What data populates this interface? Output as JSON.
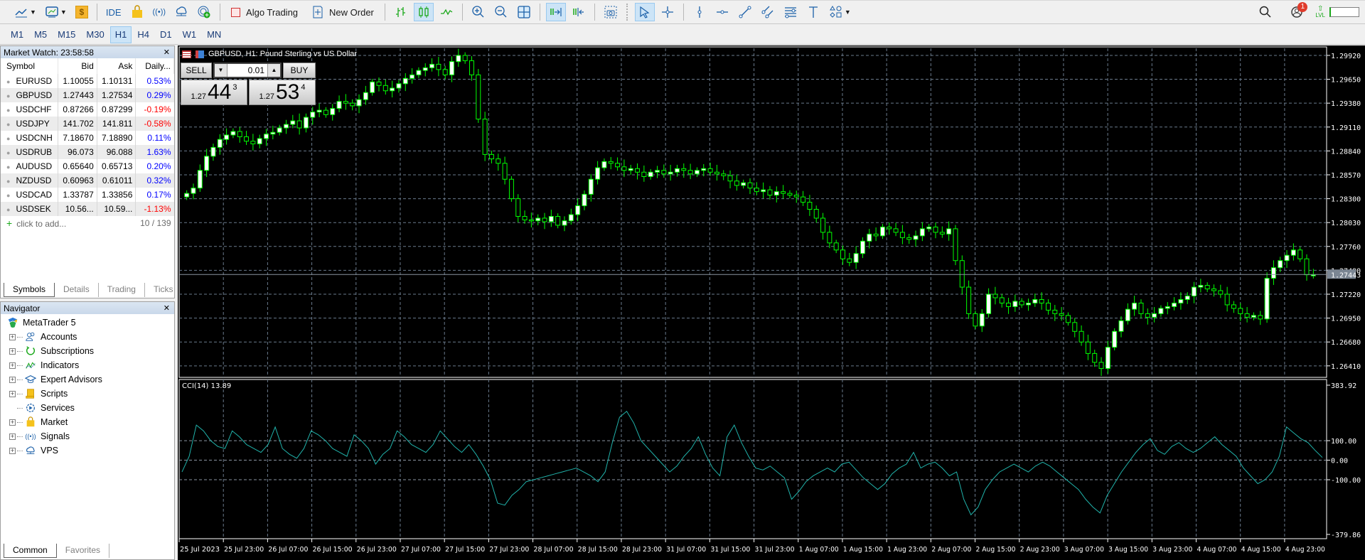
{
  "toolbar": {
    "algo_trading": "Algo Trading",
    "new_order": "New Order",
    "ide": "IDE",
    "notification_count": "1",
    "level_label": "LVL"
  },
  "timeframes": [
    {
      "label": "M1",
      "active": false
    },
    {
      "label": "M5",
      "active": false
    },
    {
      "label": "M15",
      "active": false
    },
    {
      "label": "M30",
      "active": false
    },
    {
      "label": "H1",
      "active": true
    },
    {
      "label": "H4",
      "active": false
    },
    {
      "label": "D1",
      "active": false
    },
    {
      "label": "W1",
      "active": false
    },
    {
      "label": "MN",
      "active": false
    }
  ],
  "market_watch": {
    "title": "Market Watch: 23:58:58",
    "columns": [
      "Symbol",
      "Bid",
      "Ask",
      "Daily..."
    ],
    "rows": [
      {
        "symbol": "EURUSD",
        "bid": "1.10055",
        "ask": "1.10131",
        "daily": "0.53%",
        "dir": "pos"
      },
      {
        "symbol": "GBPUSD",
        "bid": "1.27443",
        "ask": "1.27534",
        "daily": "0.29%",
        "dir": "pos"
      },
      {
        "symbol": "USDCHF",
        "bid": "0.87266",
        "ask": "0.87299",
        "daily": "-0.19%",
        "dir": "neg"
      },
      {
        "symbol": "USDJPY",
        "bid": "141.702",
        "ask": "141.811",
        "daily": "-0.58%",
        "dir": "neg"
      },
      {
        "symbol": "USDCNH",
        "bid": "7.18670",
        "ask": "7.18890",
        "daily": "0.11%",
        "dir": "pos"
      },
      {
        "symbol": "USDRUB",
        "bid": "96.073",
        "ask": "96.088",
        "daily": "1.63%",
        "dir": "pos"
      },
      {
        "symbol": "AUDUSD",
        "bid": "0.65640",
        "ask": "0.65713",
        "daily": "0.20%",
        "dir": "pos"
      },
      {
        "symbol": "NZDUSD",
        "bid": "0.60963",
        "ask": "0.61011",
        "daily": "0.32%",
        "dir": "pos"
      },
      {
        "symbol": "USDCAD",
        "bid": "1.33787",
        "ask": "1.33856",
        "daily": "0.17%",
        "dir": "pos"
      },
      {
        "symbol": "USDSEK",
        "bid": "10.56...",
        "ask": "10.59...",
        "daily": "-1.13%",
        "dir": "neg"
      }
    ],
    "add_label": "click to add...",
    "count": "10 / 139",
    "tabs": [
      "Symbols",
      "Details",
      "Trading",
      "Ticks"
    ],
    "active_tab": "Symbols"
  },
  "navigator": {
    "title": "Navigator",
    "root": "MetaTrader 5",
    "items": [
      {
        "label": "Accounts",
        "icon": "accounts-icon",
        "expandable": true
      },
      {
        "label": "Subscriptions",
        "icon": "subscriptions-icon",
        "expandable": true
      },
      {
        "label": "Indicators",
        "icon": "indicators-icon",
        "expandable": true
      },
      {
        "label": "Expert Advisors",
        "icon": "expert-advisors-icon",
        "expandable": true
      },
      {
        "label": "Scripts",
        "icon": "scripts-icon",
        "expandable": true
      },
      {
        "label": "Services",
        "icon": "services-icon",
        "expandable": false
      },
      {
        "label": "Market",
        "icon": "market-icon",
        "expandable": true
      },
      {
        "label": "Signals",
        "icon": "signals-icon",
        "expandable": true
      },
      {
        "label": "VPS",
        "icon": "vps-icon",
        "expandable": true
      }
    ],
    "tabs": [
      "Common",
      "Favorites"
    ],
    "active_tab": "Common"
  },
  "chart": {
    "title": "GBPUSD, H1:  Pound Sterling vs US Dollar",
    "trade": {
      "sell": "SELL",
      "buy": "BUY",
      "lot": "0.01",
      "bid_prefix": "1.27",
      "bid_big": "44",
      "bid_sup": "3",
      "ask_prefix": "1.27",
      "ask_big": "53",
      "ask_sup": "4"
    },
    "indicator_label": "CCI(14) 13.89"
  },
  "chart_data": [
    {
      "type": "candlestick",
      "title": "GBPUSD, H1: Pound Sterling vs US Dollar",
      "ylim": [
        1.2628,
        1.3
      ],
      "y_ticks": [
        "1.29920",
        "1.29650",
        "1.29380",
        "1.29110",
        "1.28840",
        "1.28570",
        "1.28300",
        "1.28030",
        "1.27760",
        "1.27490",
        "1.27220",
        "1.26950",
        "1.26680",
        "1.26410"
      ],
      "current_price": "1.27443",
      "x_ticks": [
        "25 Jul 2023",
        "25 Jul 23:00",
        "26 Jul 07:00",
        "26 Jul 15:00",
        "26 Jul 23:00",
        "27 Jul 07:00",
        "27 Jul 15:00",
        "27 Jul 23:00",
        "28 Jul 07:00",
        "28 Jul 15:00",
        "28 Jul 23:00",
        "31 Jul 07:00",
        "31 Jul 15:00",
        "31 Jul 23:00",
        "1 Aug 07:00",
        "1 Aug 15:00",
        "1 Aug 23:00",
        "2 Aug 07:00",
        "2 Aug 15:00",
        "2 Aug 23:00",
        "3 Aug 07:00",
        "3 Aug 15:00",
        "3 Aug 23:00",
        "4 Aug 07:00",
        "4 Aug 15:00",
        "4 Aug 23:00"
      ],
      "close_path": [
        1.2836,
        1.2842,
        1.2862,
        1.2878,
        1.2888,
        1.2897,
        1.2902,
        1.2906,
        1.29,
        1.2895,
        1.2892,
        1.2898,
        1.2903,
        1.2905,
        1.291,
        1.2914,
        1.2918,
        1.291,
        1.2922,
        1.2928,
        1.293,
        1.2925,
        1.2932,
        1.294,
        1.2938,
        1.2935,
        1.2942,
        1.295,
        1.2962,
        1.2958,
        1.2952,
        1.2955,
        1.296,
        1.2966,
        1.297,
        1.2975,
        1.2978,
        1.2982,
        1.2976,
        1.297,
        1.2985,
        1.2992,
        1.2986,
        1.297,
        1.292,
        1.288,
        1.2875,
        1.287,
        1.2852,
        1.283,
        1.281,
        1.2806,
        1.2805,
        1.2808,
        1.2804,
        1.281,
        1.28,
        1.2805,
        1.2812,
        1.2822,
        1.2835,
        1.2852,
        1.2865,
        1.2872,
        1.287,
        1.2866,
        1.2862,
        1.2864,
        1.286,
        1.2855,
        1.286,
        1.2862,
        1.2858,
        1.286,
        1.2864,
        1.2862,
        1.2858,
        1.2862,
        1.2864,
        1.286,
        1.2858,
        1.2856,
        1.285,
        1.2845,
        1.2848,
        1.2842,
        1.2838,
        1.284,
        1.2834,
        1.2838,
        1.2836,
        1.2834,
        1.2832,
        1.2826,
        1.2818,
        1.2808,
        1.2792,
        1.278,
        1.2772,
        1.2762,
        1.2758,
        1.2768,
        1.2782,
        1.279,
        1.2788,
        1.2798,
        1.2796,
        1.2792,
        1.2786,
        1.2784,
        1.2788,
        1.2796,
        1.2798,
        1.2792,
        1.279,
        1.2796,
        1.276,
        1.273,
        1.27,
        1.2686,
        1.27,
        1.2722,
        1.2718,
        1.2712,
        1.2708,
        1.2714,
        1.271,
        1.2712,
        1.2716,
        1.2712,
        1.2704,
        1.27,
        1.2698,
        1.269,
        1.268,
        1.2668,
        1.2655,
        1.2645,
        1.2638,
        1.2662,
        1.268,
        1.2692,
        1.2705,
        1.2712,
        1.27,
        1.2696,
        1.27,
        1.2706,
        1.2708,
        1.2712,
        1.2716,
        1.272,
        1.273,
        1.2732,
        1.2728,
        1.2726,
        1.2722,
        1.271,
        1.2706,
        1.27,
        1.2696,
        1.2698,
        1.2694,
        1.274,
        1.2752,
        1.276,
        1.2766,
        1.2772,
        1.2762,
        1.2744,
        1.2744
      ],
      "candle_color": "#00ff00",
      "grid": true
    },
    {
      "type": "line",
      "title": "CCI(14) 13.89",
      "ylim": [
        -379.86,
        383.92
      ],
      "y_ticks": [
        "383.92",
        "100.00",
        "0.00",
        "-100.00",
        "-379.86"
      ],
      "values": [
        -60,
        20,
        180,
        150,
        100,
        70,
        60,
        150,
        120,
        80,
        60,
        40,
        80,
        170,
        60,
        30,
        10,
        60,
        150,
        130,
        100,
        60,
        40,
        20,
        130,
        100,
        60,
        -20,
        30,
        60,
        150,
        120,
        80,
        60,
        40,
        80,
        150,
        110,
        70,
        40,
        80,
        30,
        -30,
        -100,
        -220,
        -230,
        -180,
        -150,
        -110,
        -100,
        -90,
        -80,
        -70,
        -60,
        -50,
        -40,
        -60,
        -80,
        -110,
        -60,
        90,
        220,
        250,
        190,
        100,
        60,
        20,
        -20,
        -60,
        -30,
        20,
        60,
        120,
        30,
        -40,
        -80,
        120,
        180,
        90,
        20,
        -40,
        -50,
        -30,
        -60,
        -90,
        -200,
        -160,
        -110,
        -80,
        -60,
        -40,
        -60,
        -20,
        -10,
        -50,
        -90,
        -120,
        -150,
        -120,
        -70,
        -40,
        -20,
        40,
        -40,
        -20,
        -10,
        -40,
        -80,
        -60,
        -200,
        -280,
        -240,
        -150,
        -100,
        -60,
        -40,
        -20,
        -40,
        -60,
        -30,
        -10,
        -30,
        -60,
        -90,
        -120,
        -150,
        -200,
        -240,
        -270,
        -180,
        -120,
        -60,
        -10,
        40,
        80,
        110,
        50,
        30,
        70,
        90,
        60,
        40,
        60,
        90,
        120,
        80,
        50,
        20,
        -40,
        -80,
        -120,
        -100,
        -60,
        20,
        170,
        140,
        110,
        90,
        50,
        13.89
      ],
      "line_color": "#20b2aa",
      "reference_levels": [
        100,
        0,
        -100
      ]
    }
  ]
}
